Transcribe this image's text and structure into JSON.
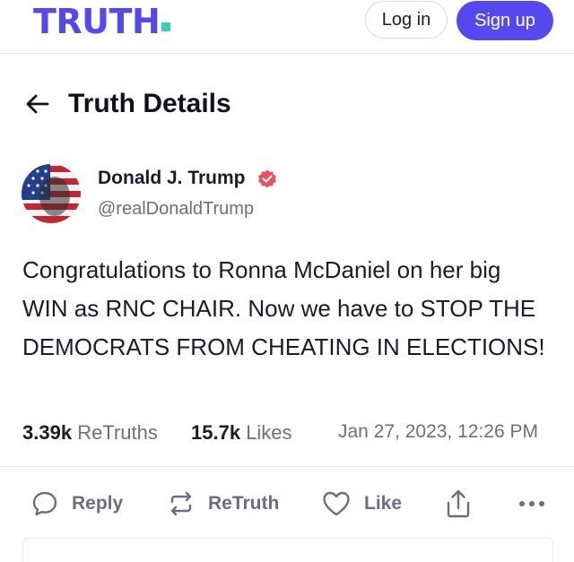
{
  "header": {
    "logo_text": "TRUTH",
    "logo_color": "#5448ee",
    "logo_dot_color": "#3ccfb6",
    "login_label": "Log in",
    "signup_label": "Sign up"
  },
  "page": {
    "title": "Truth Details",
    "back_icon": "arrow-left-icon"
  },
  "post": {
    "author_name": "Donald J. Trump",
    "author_handle": "@realDonaldTrump",
    "verified_icon": "verified-badge-icon",
    "text": "Congratulations to Ronna McDaniel on her big WIN as RNC CHAIR. Now we have to STOP THE DEMOCRATS FROM CHEATING IN ELECTIONS!",
    "retruths_count": "3.39k",
    "retruths_label": "ReTruths",
    "likes_count": "15.7k",
    "likes_label": "Likes",
    "timestamp": "Jan 27, 2023, 12:26 PM"
  },
  "actions": {
    "reply_label": "Reply",
    "retruth_label": "ReTruth",
    "like_label": "Like",
    "share_icon": "share-icon",
    "more_icon": "more-dots-icon"
  },
  "colors": {
    "accent": "#5448ee",
    "verified": "#e8505b",
    "muted_text": "#6b6e82"
  }
}
